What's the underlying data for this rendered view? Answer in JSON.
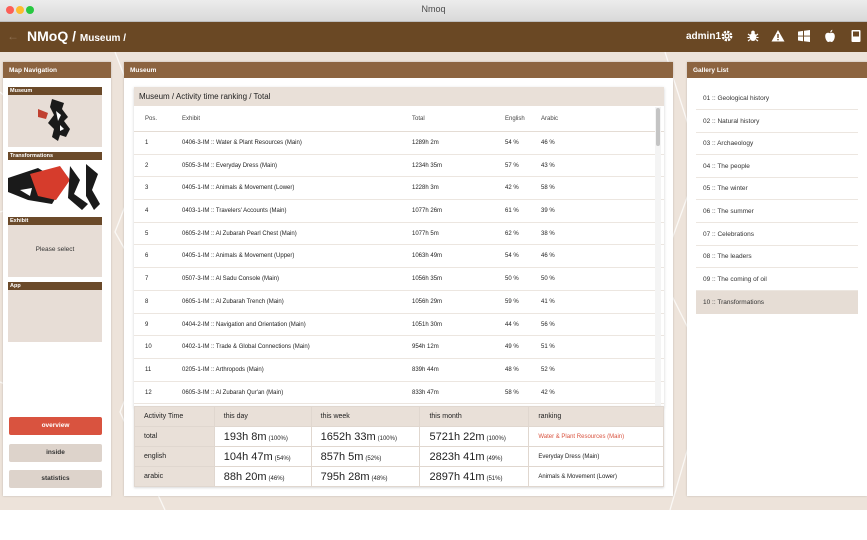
{
  "window": {
    "title": "Nmoq"
  },
  "header": {
    "brand": "NMoQ / ",
    "breadcrumb": "Museum /",
    "user": "admin1"
  },
  "icons": [
    "back-arrow-icon",
    "gear-icon",
    "bug-icon",
    "warning-icon",
    "windows-icon",
    "apple-icon",
    "book-icon"
  ],
  "nav": {
    "title": "Map Navigation",
    "boxes": [
      "Museum",
      "Transformations",
      "Exhibit",
      "App"
    ],
    "exhibit_placeholder": "Please select",
    "buttons": {
      "overview": "overview",
      "inside": "inside",
      "statistics": "statistics"
    },
    "active": "overview"
  },
  "main": {
    "panel_title": "Museum",
    "table_title": "Museum / Activity time ranking / Total",
    "columns": [
      "Pos.",
      "Exhibit",
      "Total",
      "English",
      "Arabic"
    ],
    "rows": [
      {
        "pos": "1",
        "exhibit": "0406-3-IM :: Water & Plant Resources (Main)",
        "total": "1289h 2m",
        "english": "54 %",
        "arabic": "46 %"
      },
      {
        "pos": "2",
        "exhibit": "0505-3-IM :: Everyday Dress (Main)",
        "total": "1234h 35m",
        "english": "57 %",
        "arabic": "43 %"
      },
      {
        "pos": "3",
        "exhibit": "0405-1-IM :: Animals & Movement (Lower)",
        "total": "1228h 3m",
        "english": "42 %",
        "arabic": "58 %"
      },
      {
        "pos": "4",
        "exhibit": "0403-1-IM :: Travelers' Accounts (Main)",
        "total": "1077h 26m",
        "english": "61 %",
        "arabic": "39 %"
      },
      {
        "pos": "5",
        "exhibit": "0605-2-IM :: Al Zubarah Pearl Chest (Main)",
        "total": "1077h 5m",
        "english": "62 %",
        "arabic": "38 %"
      },
      {
        "pos": "6",
        "exhibit": "0405-1-IM :: Animals & Movement (Upper)",
        "total": "1063h 49m",
        "english": "54 %",
        "arabic": "46 %"
      },
      {
        "pos": "7",
        "exhibit": "0507-3-IM :: Al Sadu Console (Main)",
        "total": "1056h 35m",
        "english": "50 %",
        "arabic": "50 %"
      },
      {
        "pos": "8",
        "exhibit": "0605-1-IM :: Al Zubarah Trench (Main)",
        "total": "1056h 29m",
        "english": "59 %",
        "arabic": "41 %"
      },
      {
        "pos": "9",
        "exhibit": "0404-2-IM :: Navigation and Orientation (Main)",
        "total": "1051h 30m",
        "english": "44 %",
        "arabic": "56 %"
      },
      {
        "pos": "10",
        "exhibit": "0402-1-IM :: Trade & Global Connections (Main)",
        "total": "954h 12m",
        "english": "49 %",
        "arabic": "51 %"
      },
      {
        "pos": "11",
        "exhibit": "0205-1-IM :: Arthropods (Main)",
        "total": "839h 44m",
        "english": "48 %",
        "arabic": "52 %"
      },
      {
        "pos": "12",
        "exhibit": "0605-3-IM :: Al Zubarah Qur'an (Main)",
        "total": "833h 47m",
        "english": "58 %",
        "arabic": "42 %"
      }
    ]
  },
  "summary": {
    "headers": [
      "Activity Time",
      "this day",
      "this week",
      "this month",
      "ranking"
    ],
    "rows": [
      {
        "label": "total",
        "day": "193h 8m",
        "day_pct": "(100%)",
        "week": "1652h 33m",
        "week_pct": "(100%)",
        "month": "5721h 22m",
        "month_pct": "(100%)",
        "ranking": "Water & Plant Resources (Main)"
      },
      {
        "label": "english",
        "day": "104h 47m",
        "day_pct": "(54%)",
        "week": "857h 5m",
        "week_pct": "(52%)",
        "month": "2823h 41m",
        "month_pct": "(49%)",
        "ranking": "Everyday Dress (Main)"
      },
      {
        "label": "arabic",
        "day": "88h 20m",
        "day_pct": "(46%)",
        "week": "795h 28m",
        "week_pct": "(48%)",
        "month": "2897h 41m",
        "month_pct": "(51%)",
        "ranking": "Animals & Movement (Lower)"
      }
    ]
  },
  "gallery": {
    "title": "Gallery List",
    "items": [
      "01 :: Geological history",
      "02 :: Natural history",
      "03 :: Archaeology",
      "04 :: The people",
      "05 :: The winter",
      "06 :: The summer",
      "07 :: Celebrations",
      "08 :: The leaders",
      "09 :: The coming of oil",
      "10 :: Transformations"
    ],
    "selected": "10 :: Transformations"
  },
  "colors": {
    "header": "#6a4824",
    "panel_header": "#8c6440",
    "accent_red": "#d9533f",
    "background": "#ede3da"
  }
}
